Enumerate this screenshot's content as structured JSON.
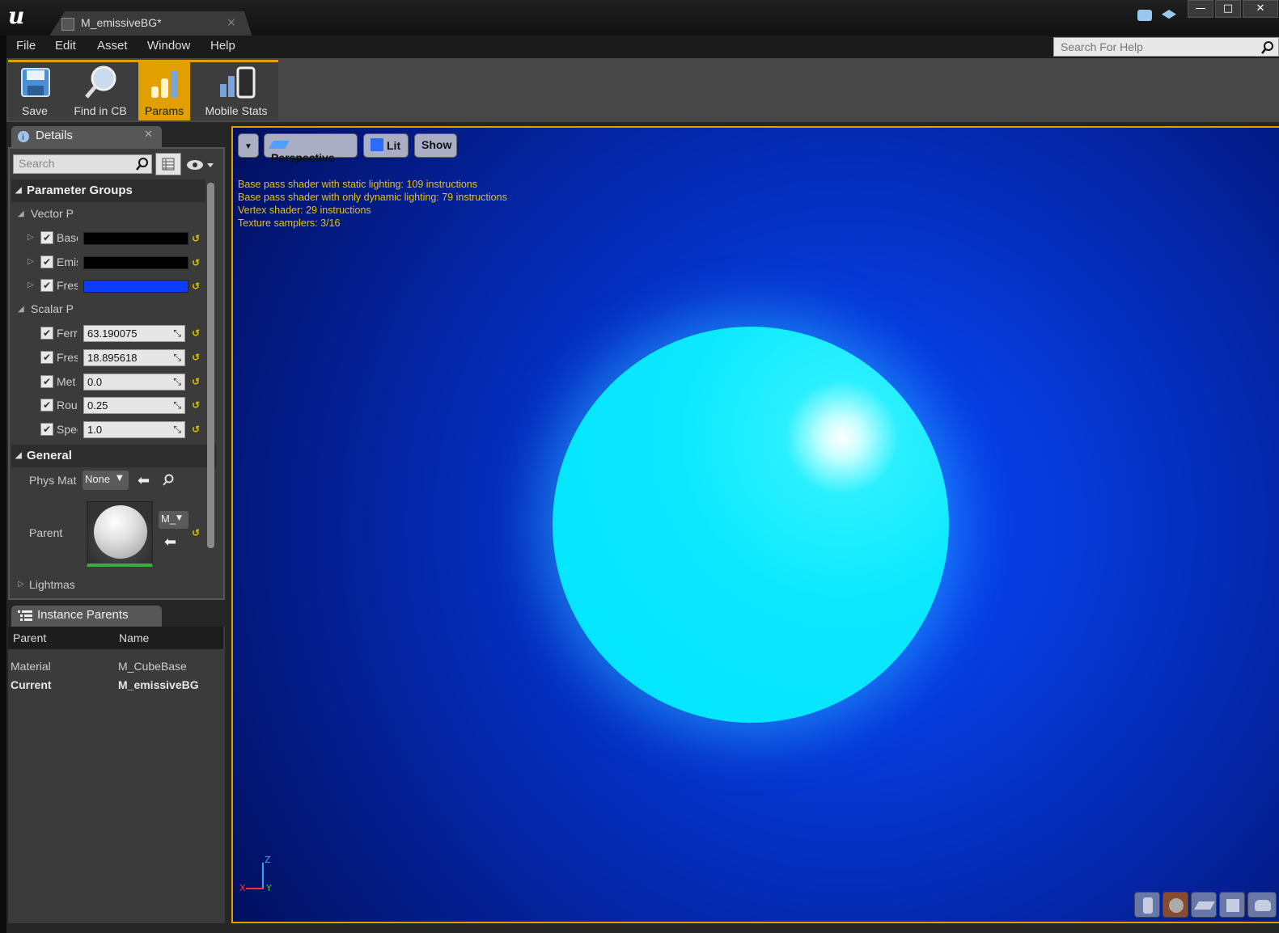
{
  "window": {
    "tab_title": "M_emissiveBG*",
    "minimize": "—",
    "maximize": "□",
    "close": "✕"
  },
  "menu": [
    "File",
    "Edit",
    "Asset",
    "Window",
    "Help"
  ],
  "help_search": {
    "placeholder": "Search For Help"
  },
  "toolbar": [
    {
      "label": "Save",
      "icon": "save-icon",
      "active": false
    },
    {
      "label": "Find in CB",
      "icon": "search-icon",
      "active": false
    },
    {
      "label": "Params",
      "icon": "params-icon",
      "active": true
    },
    {
      "label": "Mobile Stats",
      "icon": "mobile-stats-icon",
      "active": false
    }
  ],
  "details": {
    "tab_title": "Details",
    "search_placeholder": "Search",
    "parameter_groups": "Parameter Groups",
    "vector_group": "Vector P",
    "vector_params": [
      {
        "label": "Base",
        "color": "#000000"
      },
      {
        "label": "Emis",
        "color": "#000000"
      },
      {
        "label": "Fres",
        "color": "#0a3dff"
      }
    ],
    "scalar_group": "Scalar P",
    "scalar_params": [
      {
        "label": "Ferr",
        "value": "63.190075"
      },
      {
        "label": "Fres",
        "value": "18.895618"
      },
      {
        "label": "Met",
        "value": "0.0"
      },
      {
        "label": "Rou",
        "value": "0.25"
      },
      {
        "label": "Spec",
        "value": "1.0"
      }
    ],
    "general": "General",
    "phys_mat_label": "Phys Mat",
    "phys_mat_value": "None",
    "parent_label": "Parent",
    "parent_value": "M_",
    "lightmass": "Lightmas"
  },
  "instance_parents": {
    "tab_title": "Instance Parents",
    "columns": [
      "Parent",
      "Name"
    ],
    "rows": [
      {
        "parent": "Material",
        "name": "M_CubeBase"
      },
      {
        "parent": "Current",
        "name": "M_emissiveBG"
      }
    ]
  },
  "viewport": {
    "perspective": "Perspective",
    "lit": "Lit",
    "show": "Show",
    "stats": [
      "Base pass shader with static lighting: 109 instructions",
      "Base pass shader with only dynamic lighting: 79 instructions",
      "Vertex shader: 29 instructions",
      "Texture samplers: 3/16"
    ],
    "axis_x": "X",
    "axis_y": "Y",
    "axis_z": "Z",
    "background_color": "#0637e0",
    "sphere_color": "#00e5ff"
  }
}
